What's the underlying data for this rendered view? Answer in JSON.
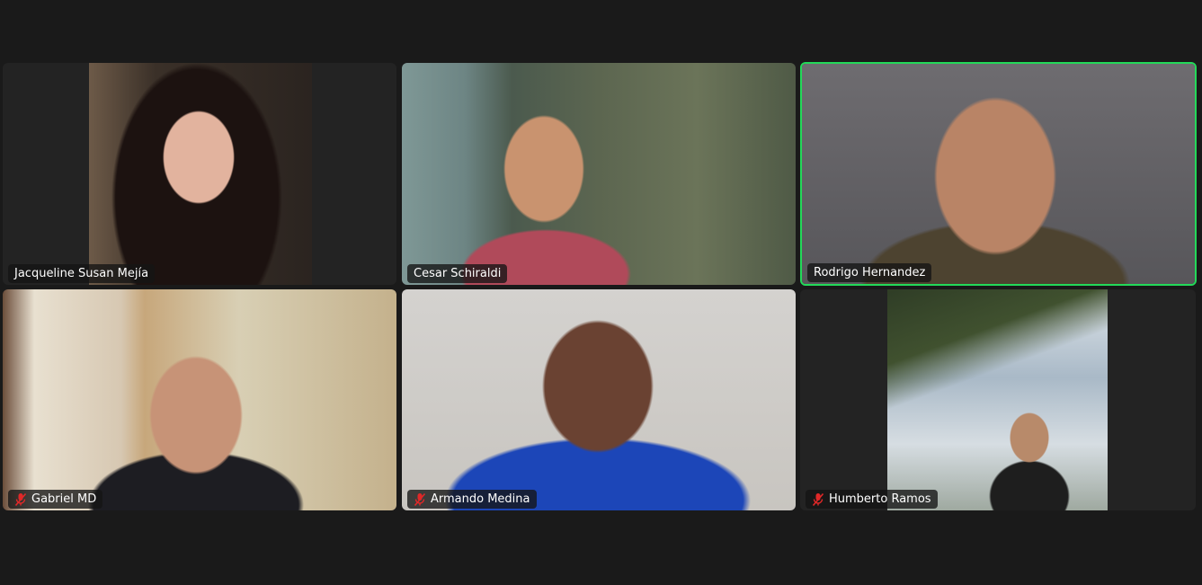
{
  "meeting": {
    "participants": [
      {
        "name": "Jacqueline Susan Mejía",
        "muted": false,
        "speaking": false
      },
      {
        "name": "Cesar Schiraldi",
        "muted": false,
        "speaking": false
      },
      {
        "name": "Rodrigo Hernandez",
        "muted": false,
        "speaking": true
      },
      {
        "name": "Gabriel MD",
        "muted": true,
        "speaking": false
      },
      {
        "name": "Armando Medina",
        "muted": true,
        "speaking": false
      },
      {
        "name": "Humberto Ramos",
        "muted": true,
        "speaking": false
      }
    ],
    "colors": {
      "background": "#1a1a1a",
      "tile": "#232323",
      "active_speaker_border": "#23d959",
      "muted_icon": "#e02828"
    },
    "icons": {
      "muted": "mic-muted-icon"
    }
  }
}
